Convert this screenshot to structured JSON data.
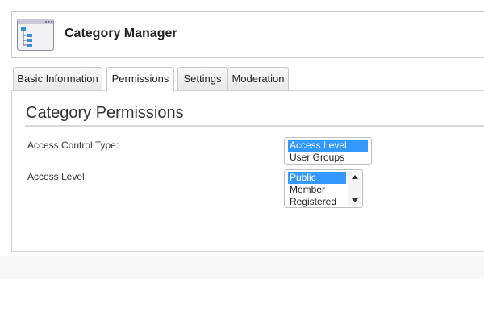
{
  "header": {
    "title": "Category Manager",
    "icon": "category-tree-icon"
  },
  "tabs": [
    {
      "label": "Basic Information",
      "active": false
    },
    {
      "label": "Permissions",
      "active": true
    },
    {
      "label": "Settings",
      "active": false
    },
    {
      "label": "Moderation",
      "active": false
    }
  ],
  "permissions": {
    "title": "Category Permissions",
    "access_control_type": {
      "label": "Access Control Type:",
      "options": [
        "Access Level",
        "User Groups"
      ],
      "selected": "Access Level"
    },
    "access_level": {
      "label": "Access Level:",
      "options": [
        "Public",
        "Member",
        "Registered"
      ],
      "selected": "Public"
    }
  },
  "colors": {
    "selection": "#3399ff",
    "border": "#c8c8c8"
  }
}
